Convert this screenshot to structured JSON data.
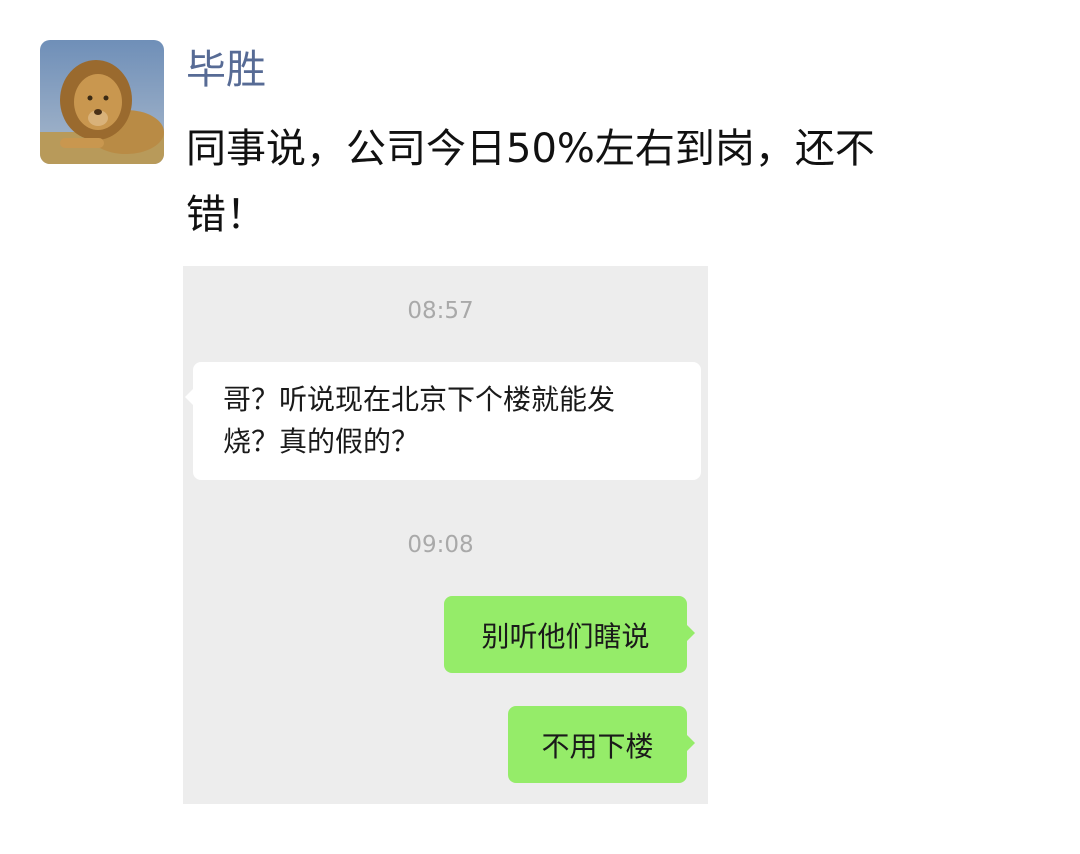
{
  "post": {
    "author": "毕胜",
    "avatar_icon": "lion-avatar-icon",
    "text_line1": "同事说，公司今日50%左右到岗，还不",
    "text_line2": "错！"
  },
  "chat_screenshot": {
    "background": "#ededed",
    "timestamps": [
      "08:57",
      "09:08"
    ],
    "incoming": {
      "line1": "哥？听说现在北京下个楼就能发",
      "line2": "烧？真的假的？"
    },
    "outgoing": [
      "别听他们瞎说",
      "不用下楼"
    ],
    "colors": {
      "incoming_bubble": "#ffffff",
      "outgoing_bubble": "#95ec69",
      "author_name": "#576b95"
    }
  }
}
